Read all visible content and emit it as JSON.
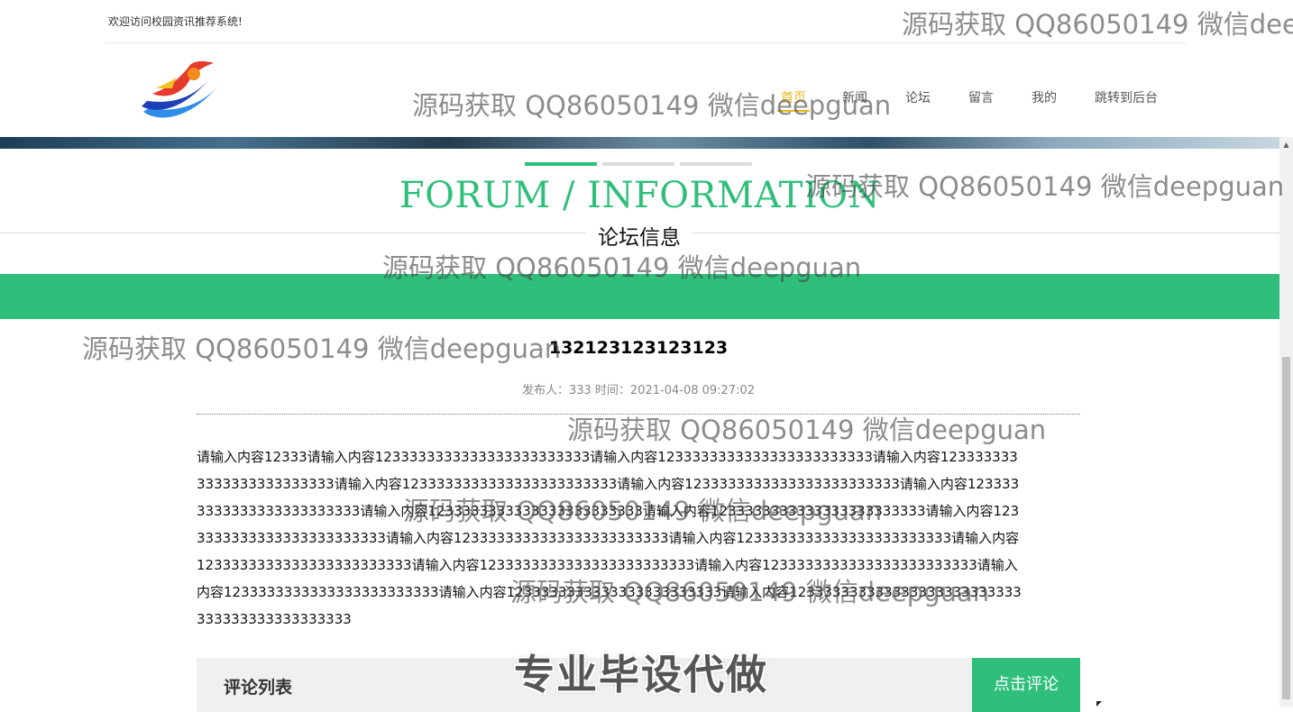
{
  "header": {
    "welcome": "欢迎访问校园资讯推荐系统!",
    "nav": [
      {
        "label": "首页",
        "active": true
      },
      {
        "label": "新闻",
        "active": false
      },
      {
        "label": "论坛",
        "active": false
      },
      {
        "label": "留言",
        "active": false
      },
      {
        "label": "我的",
        "active": false
      },
      {
        "label": "跳转到后台",
        "active": false
      }
    ]
  },
  "logo": {
    "icon": "runner-swoosh-logo",
    "colors": [
      "#e53a2c",
      "#1f4fcf",
      "#2d8de8"
    ]
  },
  "slider": {
    "dot_count": 3,
    "active_index": 0
  },
  "section": {
    "title_en": "FORUM / INFORMATION",
    "title_cn": "论坛信息",
    "accent_color": "#2fbf7b"
  },
  "post": {
    "title": "132123123123123",
    "meta": "发布人：333 时间：2021-04-08 09:27:02",
    "body": "请输入内容12333请输入内容1233333333333333333333333请输入内容1233333333333333333333333请输入内容1233333333333333333333333请输入内容1233333333333333333333333请输入内容1233333333333333333333333请输入内容1233333333333333333333333请输入内容1233333333333333333333333请输入内容1233333333333333333333333请输入内容1233333333333333333333333请输入内容1233333333333333333333333请输入内容1233333333333333333333333请输入内容1233333333333333333333333请输入内容1233333333333333333333333请输入内容1233333333333333333333333请输入内容1233333333333333333333333请输入内容1233333333333333333333333请输入内容123333333333333333333333333333333333333333333"
  },
  "comments": {
    "title": "评论列表",
    "button": "点击评论"
  },
  "watermarks": {
    "text": "源码获取 QQ86050149 微信deepguan",
    "top_right": "源码获取 QQ86050149 微信dee",
    "banner": "专业毕设代做"
  }
}
